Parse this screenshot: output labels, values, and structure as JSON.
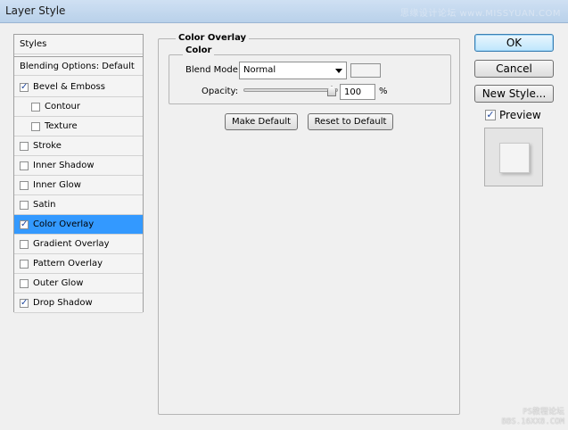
{
  "window": {
    "title": "Layer Style",
    "watermark_top": "思缘设计论坛 www.MISSYUAN.COM",
    "watermark_bottom_line1": "PS教程论坛",
    "watermark_bottom_line2": "BBS.16XX8.COM"
  },
  "style_list": {
    "header": "Styles",
    "blending_options": "Blending Options: Default",
    "items": [
      {
        "label": "Bevel & Emboss",
        "checked": true,
        "indent": false
      },
      {
        "label": "Contour",
        "checked": false,
        "indent": true
      },
      {
        "label": "Texture",
        "checked": false,
        "indent": true
      },
      {
        "label": "Stroke",
        "checked": false,
        "indent": false
      },
      {
        "label": "Inner Shadow",
        "checked": false,
        "indent": false
      },
      {
        "label": "Inner Glow",
        "checked": false,
        "indent": false
      },
      {
        "label": "Satin",
        "checked": false,
        "indent": false
      },
      {
        "label": "Color Overlay",
        "checked": true,
        "indent": false,
        "selected": true
      },
      {
        "label": "Gradient Overlay",
        "checked": false,
        "indent": false
      },
      {
        "label": "Pattern Overlay",
        "checked": false,
        "indent": false
      },
      {
        "label": "Outer Glow",
        "checked": false,
        "indent": false
      },
      {
        "label": "Drop Shadow",
        "checked": true,
        "indent": false
      }
    ]
  },
  "panel": {
    "group_title": "Color Overlay",
    "subgroup_title": "Color",
    "blend_mode_label": "Blend Mode:",
    "blend_mode_value": "Normal",
    "overlay_color": "#f3f3f3",
    "opacity_label": "Opacity:",
    "opacity_value": "100",
    "opacity_unit": "%",
    "make_default": "Make Default",
    "reset_default": "Reset to Default"
  },
  "buttons": {
    "ok": "OK",
    "cancel": "Cancel",
    "new_style": "New Style..."
  },
  "preview": {
    "label": "Preview",
    "checked": true
  },
  "colors": {
    "selection": "#3399ff",
    "check": "#21489c"
  }
}
